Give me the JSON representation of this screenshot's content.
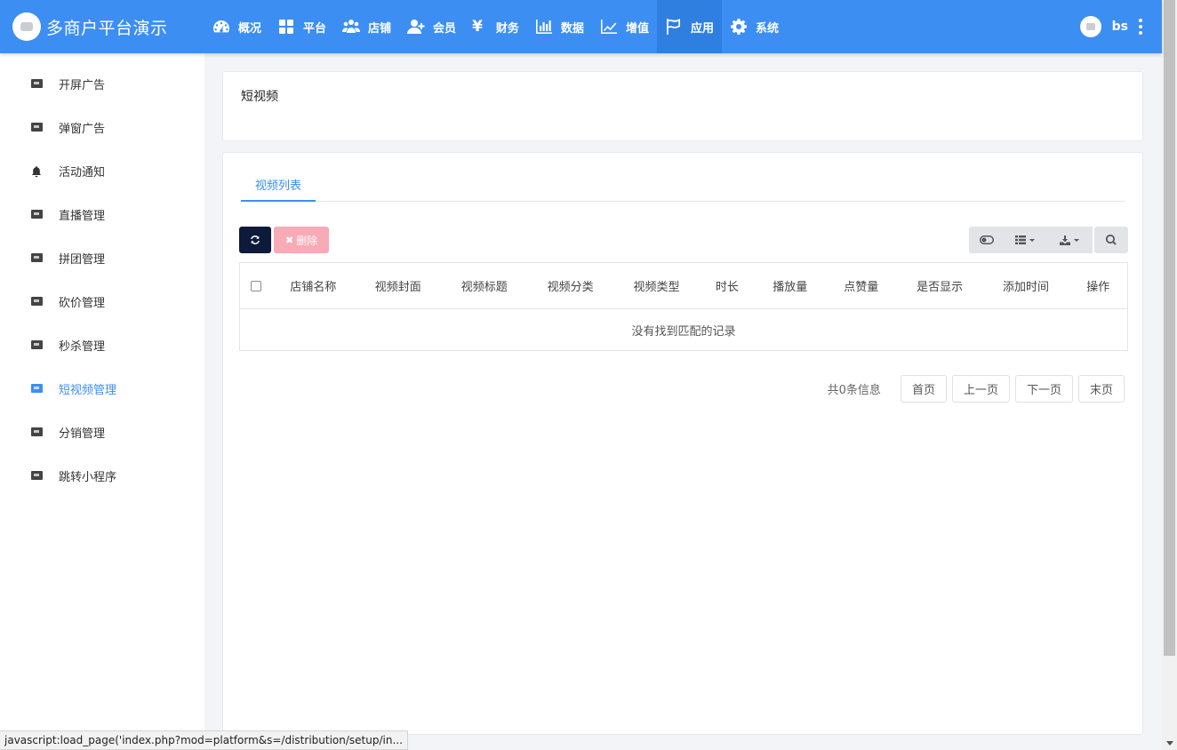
{
  "header": {
    "brand_title": "多商户平台演示",
    "nav": [
      {
        "label": "概况",
        "icon": "dashboard-icon"
      },
      {
        "label": "平台",
        "icon": "grid-icon"
      },
      {
        "label": "店铺",
        "icon": "users-icon"
      },
      {
        "label": "会员",
        "icon": "user-plus-icon"
      },
      {
        "label": "财务",
        "icon": "yen-icon",
        "glyph": "¥"
      },
      {
        "label": "数据",
        "icon": "bar-chart-icon"
      },
      {
        "label": "增值",
        "icon": "line-chart-icon"
      },
      {
        "label": "应用",
        "icon": "flag-icon",
        "active": true
      },
      {
        "label": "系统",
        "icon": "gear-icon"
      }
    ],
    "user": {
      "name": "bs"
    }
  },
  "sidebar": {
    "items": [
      {
        "label": "开屏广告",
        "icon": "ad-icon"
      },
      {
        "label": "弹窗广告",
        "icon": "ad-icon"
      },
      {
        "label": "活动通知",
        "icon": "bell-icon"
      },
      {
        "label": "直播管理",
        "icon": "ad-icon"
      },
      {
        "label": "拼团管理",
        "icon": "ad-icon"
      },
      {
        "label": "砍价管理",
        "icon": "ad-icon"
      },
      {
        "label": "秒杀管理",
        "icon": "ad-icon"
      },
      {
        "label": "短视频管理",
        "icon": "ad-icon",
        "active": true
      },
      {
        "label": "分销管理",
        "icon": "ad-icon"
      },
      {
        "label": "跳转小程序",
        "icon": "ad-icon"
      }
    ]
  },
  "page": {
    "title": "短视频",
    "tab": "视频列表",
    "toolbar": {
      "delete_label": "删除"
    },
    "table": {
      "columns": [
        "店铺名称",
        "视频封面",
        "视频标题",
        "视频分类",
        "视频类型",
        "时长",
        "播放量",
        "点赞量",
        "是否显示",
        "添加时间",
        "操作"
      ],
      "empty_text": "没有找到匹配的记录"
    },
    "pager": {
      "info": "共0条信息",
      "first": "首页",
      "prev": "上一页",
      "next": "下一页",
      "last": "末页"
    }
  },
  "status_bar": "javascript:load_page('index.php?mod=platform&s=/distribution/setup/in..."
}
